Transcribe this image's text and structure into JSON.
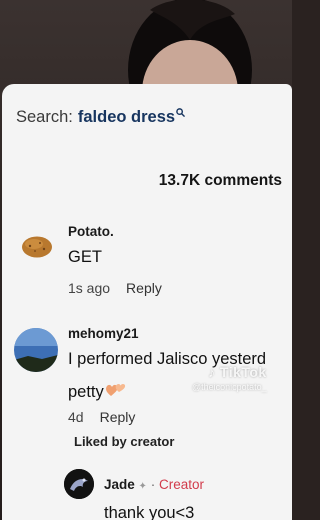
{
  "search": {
    "prefix": "Search:",
    "term": "faldeo dress"
  },
  "comments_header": {
    "count": "13.7K comments"
  },
  "comments": [
    {
      "username": "Potato.",
      "text": "GET",
      "time": "1s ago",
      "reply_label": "Reply",
      "avatar_icon": "potato-icon"
    },
    {
      "username": "mehomy21",
      "text": "I performed Jalisco yesterd",
      "text_line2": "petty",
      "emoji_icon": "orange-hearts-icon",
      "time": "4d",
      "reply_label": "Reply",
      "liked_by_creator": "Liked by creator",
      "avatar_icon": "sky-landscape-icon"
    }
  ],
  "reply": {
    "username": "Jade",
    "separator": "·",
    "creator_label": "Creator",
    "text": "thank you<3",
    "avatar_icon": "dragon-icon"
  },
  "watermark": {
    "logo": "TikTok",
    "handle": "@theiconicpotato_"
  },
  "colors": {
    "search_term": "#17355f",
    "creator_tag": "#d23b4b",
    "panel_bg": "#f4f4f4"
  }
}
